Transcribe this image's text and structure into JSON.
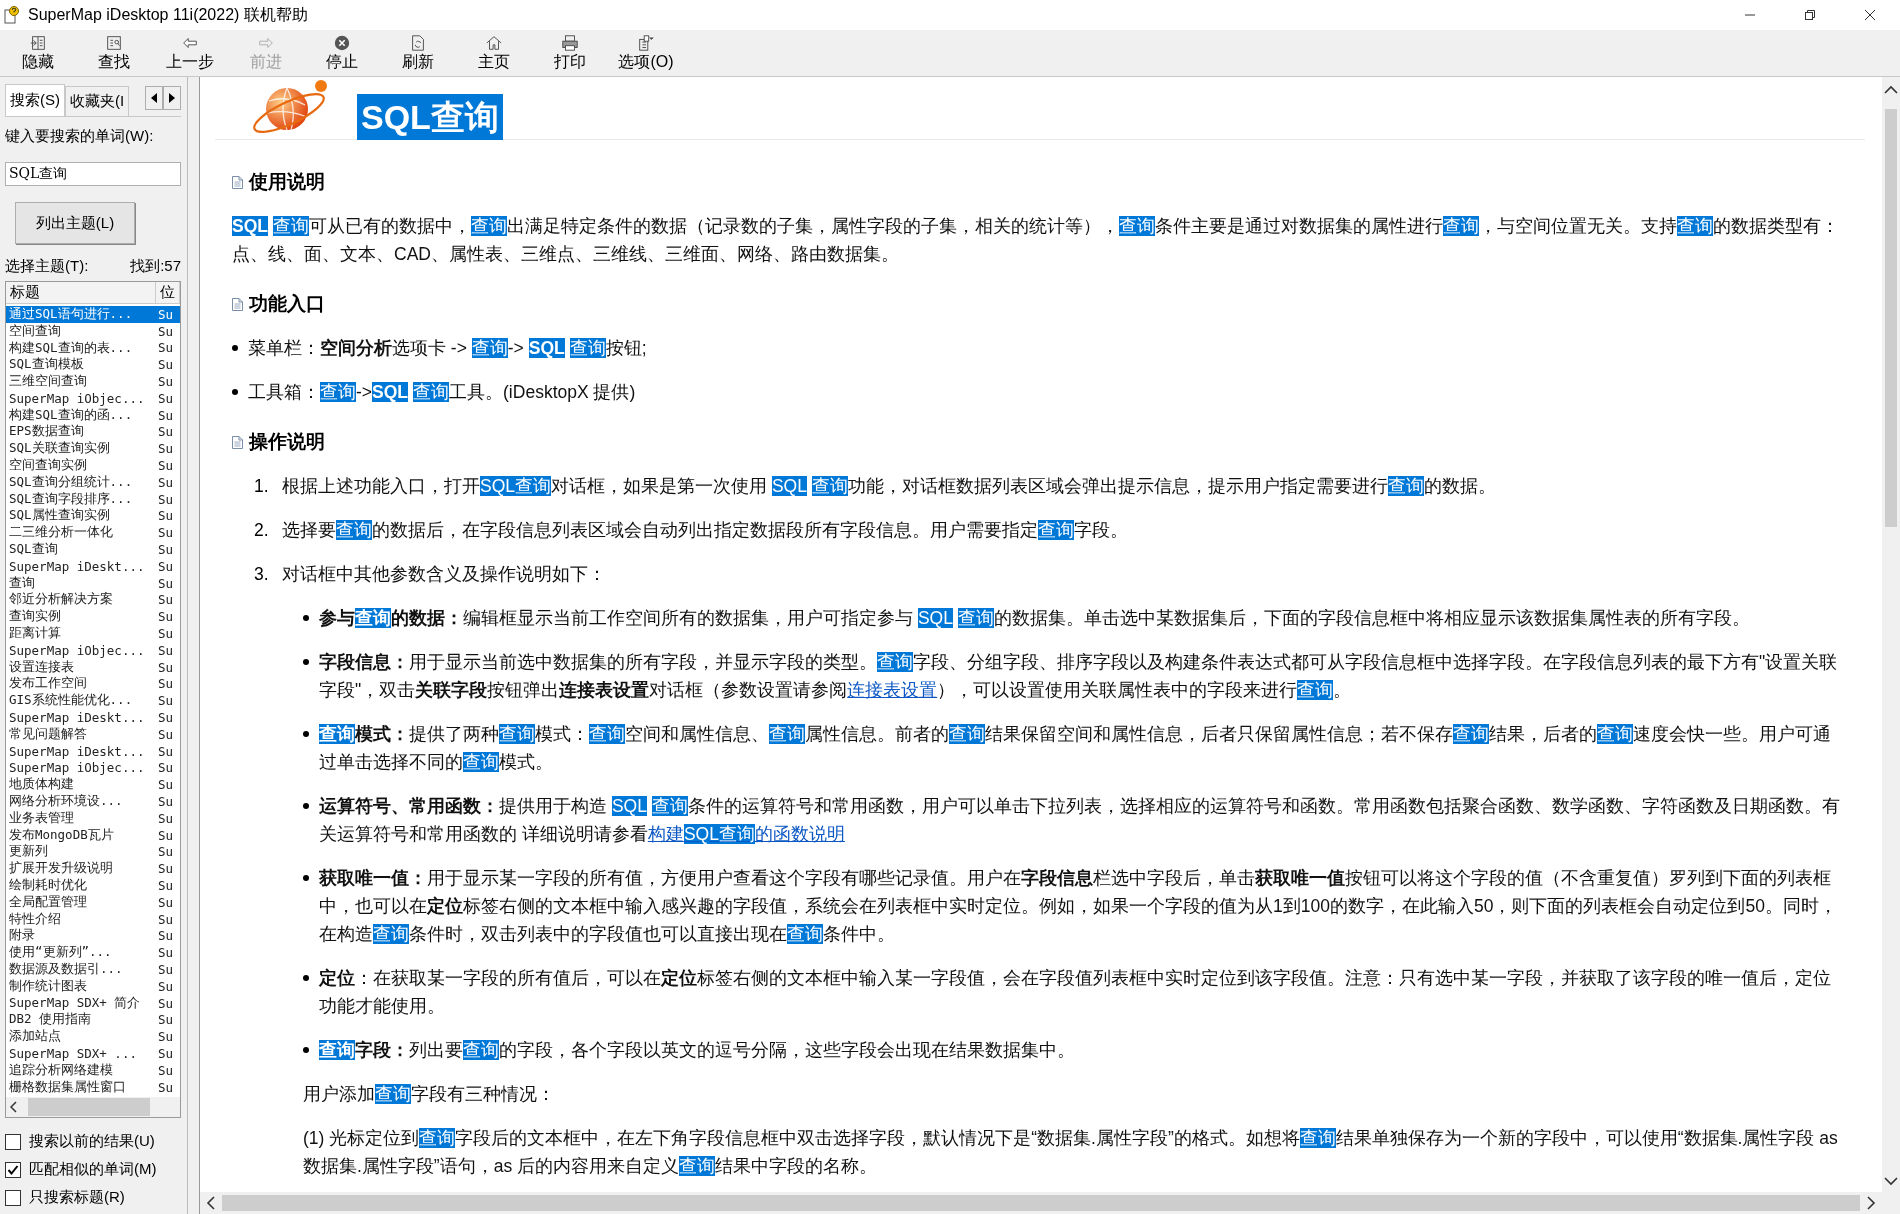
{
  "window": {
    "title": "SuperMap iDesktop 11i(2022) 联机帮助"
  },
  "toolbar": [
    {
      "label": "隐藏",
      "disabled": false
    },
    {
      "label": "查找",
      "disabled": false
    },
    {
      "label": "上一步",
      "disabled": false
    },
    {
      "label": "前进",
      "disabled": true
    },
    {
      "label": "停止",
      "disabled": false
    },
    {
      "label": "刷新",
      "disabled": false
    },
    {
      "label": "主页",
      "disabled": false
    },
    {
      "label": "打印",
      "disabled": false
    },
    {
      "label": "选项(O)",
      "disabled": false
    }
  ],
  "nav_pane": {
    "tabs": [
      {
        "label": "搜索(S)",
        "selected": true
      },
      {
        "label": "收藏夹(I",
        "selected": false
      }
    ],
    "search_label": "键入要搜索的单词(W):",
    "search_value": "SQL查询",
    "list_button": "列出主题(L)",
    "topics_label": "选择主题(T):",
    "found_count": "找到:57",
    "columns": [
      "标题",
      "位"
    ],
    "topics": [
      {
        "title": "通过SQL语句进行...",
        "location": "Su",
        "selected": true
      },
      {
        "title": "空间查询",
        "location": "Su",
        "selected": false
      },
      {
        "title": "构建SQL查询的表...",
        "location": "Su",
        "selected": false
      },
      {
        "title": "SQL查询模板",
        "location": "Su",
        "selected": false
      },
      {
        "title": "三维空间查询",
        "location": "Su",
        "selected": false
      },
      {
        "title": "SuperMap iObjec...",
        "location": "Su",
        "selected": false
      },
      {
        "title": "构建SQL查询的函...",
        "location": "Su",
        "selected": false
      },
      {
        "title": "EPS数据查询",
        "location": "Su",
        "selected": false
      },
      {
        "title": "SQL关联查询实例",
        "location": "Su",
        "selected": false
      },
      {
        "title": "空间查询实例",
        "location": "Su",
        "selected": false
      },
      {
        "title": "SQL查询分组统计...",
        "location": "Su",
        "selected": false
      },
      {
        "title": "SQL查询字段排序...",
        "location": "Su",
        "selected": false
      },
      {
        "title": "SQL属性查询实例",
        "location": "Su",
        "selected": false
      },
      {
        "title": "二三维分析一体化",
        "location": "Su",
        "selected": false
      },
      {
        "title": "SQL查询",
        "location": "Su",
        "selected": false
      },
      {
        "title": "SuperMap iDeskt...",
        "location": "Su",
        "selected": false
      },
      {
        "title": "查询",
        "location": "Su",
        "selected": false
      },
      {
        "title": "邻近分析解决方案",
        "location": "Su",
        "selected": false
      },
      {
        "title": "查询实例",
        "location": "Su",
        "selected": false
      },
      {
        "title": "距离计算",
        "location": "Su",
        "selected": false
      },
      {
        "title": "SuperMap iObjec...",
        "location": "Su",
        "selected": false
      },
      {
        "title": "设置连接表",
        "location": "Su",
        "selected": false
      },
      {
        "title": "发布工作空间",
        "location": "Su",
        "selected": false
      },
      {
        "title": "GIS系统性能优化...",
        "location": "Su",
        "selected": false
      },
      {
        "title": "SuperMap iDeskt...",
        "location": "Su",
        "selected": false
      },
      {
        "title": "常见问题解答",
        "location": "Su",
        "selected": false
      },
      {
        "title": "SuperMap iDeskt...",
        "location": "Su",
        "selected": false
      },
      {
        "title": "SuperMap iObjec...",
        "location": "Su",
        "selected": false
      },
      {
        "title": "地质体构建",
        "location": "Su",
        "selected": false
      },
      {
        "title": "网络分析环境设...",
        "location": "Su",
        "selected": false
      },
      {
        "title": "业务表管理",
        "location": "Su",
        "selected": false
      },
      {
        "title": "发布MongoDB瓦片",
        "location": "Su",
        "selected": false
      },
      {
        "title": "更新列",
        "location": "Su",
        "selected": false
      },
      {
        "title": "扩展开发升级说明",
        "location": "Su",
        "selected": false
      },
      {
        "title": "绘制耗时优化",
        "location": "Su",
        "selected": false
      },
      {
        "title": "全局配置管理",
        "location": "Su",
        "selected": false
      },
      {
        "title": "特性介绍",
        "location": "Su",
        "selected": false
      },
      {
        "title": "附录",
        "location": "Su",
        "selected": false
      },
      {
        "title": "使用“更新列”...",
        "location": "Su",
        "selected": false
      },
      {
        "title": "数据源及数据引...",
        "location": "Su",
        "selected": false
      },
      {
        "title": "制作统计图表",
        "location": "Su",
        "selected": false
      },
      {
        "title": "SuperMap SDX+ 简介",
        "location": "Su",
        "selected": false
      },
      {
        "title": "DB2 使用指南",
        "location": "Su",
        "selected": false
      },
      {
        "title": "添加站点",
        "location": "Su",
        "selected": false
      },
      {
        "title": "SuperMap SDX+ ...",
        "location": "Su",
        "selected": false
      },
      {
        "title": "追踪分析网络建模",
        "location": "Su",
        "selected": false
      },
      {
        "title": "栅格数据集属性窗口",
        "location": "Su",
        "selected": false
      }
    ],
    "options": [
      {
        "label": "搜索以前的结果(U)",
        "checked": false
      },
      {
        "label": "匹配相似的单词(M)",
        "checked": true
      },
      {
        "label": "只搜索标题(R)",
        "checked": false
      }
    ]
  },
  "page": {
    "title": {
      "text": "SQL查询",
      "highlighted": true
    },
    "sections": [
      {
        "heading": "使用说明",
        "blocks": [
          {
            "kind": "para",
            "segments": [
              {
                "kind": "boldhit",
                "t": "SQL"
              },
              {
                "kind": "hit",
                "t": "查询"
              },
              {
                "kind": "text",
                "t": "可从已有的数据中，"
              },
              {
                "kind": "hit",
                "t": "查询"
              },
              {
                "kind": "text",
                "t": "出满足特定条件的数据（记录数的子集，属性字段的子集，相关的统计等），"
              },
              {
                "kind": "hit",
                "t": "查询"
              },
              {
                "kind": "text",
                "t": "条件主要是通过对数据集的属性进行"
              },
              {
                "kind": "hit",
                "t": "查询"
              },
              {
                "kind": "text",
                "t": "，与空间位置无关。支持"
              },
              {
                "kind": "hit",
                "t": "查询"
              },
              {
                "kind": "text",
                "t": "的数据类型有：点、线、面、文本、CAD、属性表、三维点、三维线、三维面、网络、路由数据集。"
              }
            ]
          }
        ]
      },
      {
        "heading": "功能入口",
        "blocks": [
          {
            "kind": "bullet",
            "segments": [
              {
                "kind": "text",
                "t": "菜单栏："
              },
              {
                "kind": "bold",
                "t": "空间分析"
              },
              {
                "kind": "text",
                "t": "选项卡 -> "
              },
              {
                "kind": "hit",
                "t": "查询"
              },
              {
                "kind": "text",
                "t": "-> "
              },
              {
                "kind": "boldhit",
                "t": "SQL"
              },
              {
                "kind": "hit",
                "t": "查询"
              },
              {
                "kind": "text",
                "t": "按钮;"
              }
            ]
          },
          {
            "kind": "bullet",
            "segments": [
              {
                "kind": "text",
                "t": "工具箱："
              },
              {
                "kind": "hit",
                "t": "查询"
              },
              {
                "kind": "text",
                "t": "->"
              },
              {
                "kind": "boldhit",
                "t": "SQL"
              },
              {
                "kind": "hit",
                "t": "查询"
              },
              {
                "kind": "text",
                "t": "工具。(iDesktopX 提供)"
              }
            ]
          }
        ]
      },
      {
        "heading": "操作说明",
        "blocks": [
          {
            "kind": "step",
            "num": "1.",
            "segments": [
              {
                "kind": "text",
                "t": "根据上述功能入口，打开"
              },
              {
                "kind": "hit",
                "t": "SQL查询"
              },
              {
                "kind": "text",
                "t": "对话框，如果是第一次使用 "
              },
              {
                "kind": "hit",
                "t": "SQL"
              },
              {
                "kind": "hit",
                "t": "查询"
              },
              {
                "kind": "text",
                "t": "功能，对话框数据列表区域会弹出提示信息，提示用户指定需要进行"
              },
              {
                "kind": "hit",
                "t": "查询"
              },
              {
                "kind": "text",
                "t": "的数据。"
              }
            ]
          },
          {
            "kind": "step",
            "num": "2.",
            "segments": [
              {
                "kind": "text",
                "t": "选择要"
              },
              {
                "kind": "hit",
                "t": "查询"
              },
              {
                "kind": "text",
                "t": "的数据后，在字段信息列表区域会自动列出指定数据段所有字段信息。用户需要指定"
              },
              {
                "kind": "hit",
                "t": "查询"
              },
              {
                "kind": "text",
                "t": "字段。"
              }
            ]
          },
          {
            "kind": "step",
            "num": "3.",
            "segments": [
              {
                "kind": "text",
                "t": "对话框中其他参数含义及操作说明如下："
              }
            ],
            "children": [
              {
                "kind": "bullet",
                "segments": [
                  {
                    "kind": "bold",
                    "t": "参与"
                  },
                  {
                    "kind": "boldhit",
                    "t": "查询"
                  },
                  {
                    "kind": "bold",
                    "t": "的数据："
                  },
                  {
                    "kind": "text",
                    "t": "编辑框显示当前工作空间所有的数据集，用户可指定参与 "
                  },
                  {
                    "kind": "hit",
                    "t": "SQL"
                  },
                  {
                    "kind": "hit",
                    "t": "查询"
                  },
                  {
                    "kind": "text",
                    "t": "的数据集。单击选中某数据集后，下面的字段信息框中将相应显示该数据集属性表的所有字段。"
                  }
                ]
              },
              {
                "kind": "bullet",
                "segments": [
                  {
                    "kind": "bold",
                    "t": "字段信息："
                  },
                  {
                    "kind": "text",
                    "t": "用于显示当前选中数据集的所有字段，并显示字段的类型。"
                  },
                  {
                    "kind": "hit",
                    "t": "查询"
                  },
                  {
                    "kind": "text",
                    "t": "字段、分组字段、排序字段以及构建条件表达式都可从字段信息框中选择字段。在字段信息列表的最下方有\"设置关联字段\"，双击"
                  },
                  {
                    "kind": "bold",
                    "t": "关联字段"
                  },
                  {
                    "kind": "text",
                    "t": "按钮弹出"
                  },
                  {
                    "kind": "bold",
                    "t": "连接表设置"
                  },
                  {
                    "kind": "text",
                    "t": "对话框（参数设置请参阅"
                  },
                  {
                    "kind": "link",
                    "parts": [
                      {
                        "t": "连接表设置",
                        "hit": false
                      }
                    ]
                  },
                  {
                    "kind": "text",
                    "t": "），可以设置使用关联属性表中的字段来进行"
                  },
                  {
                    "kind": "hit",
                    "t": "查询"
                  },
                  {
                    "kind": "text",
                    "t": "。"
                  }
                ]
              },
              {
                "kind": "bullet",
                "segments": [
                  {
                    "kind": "boldhit",
                    "t": "查询"
                  },
                  {
                    "kind": "bold",
                    "t": "模式："
                  },
                  {
                    "kind": "text",
                    "t": "提供了两种"
                  },
                  {
                    "kind": "hit",
                    "t": "查询"
                  },
                  {
                    "kind": "text",
                    "t": "模式："
                  },
                  {
                    "kind": "hit",
                    "t": "查询"
                  },
                  {
                    "kind": "text",
                    "t": "空间和属性信息、"
                  },
                  {
                    "kind": "hit",
                    "t": "查询"
                  },
                  {
                    "kind": "text",
                    "t": "属性信息。前者的"
                  },
                  {
                    "kind": "hit",
                    "t": "查询"
                  },
                  {
                    "kind": "text",
                    "t": "结果保留空间和属性信息，后者只保留属性信息；若不保存"
                  },
                  {
                    "kind": "hit",
                    "t": "查询"
                  },
                  {
                    "kind": "text",
                    "t": "结果，后者的"
                  },
                  {
                    "kind": "hit",
                    "t": "查询"
                  },
                  {
                    "kind": "text",
                    "t": "速度会快一些。用户可通过单击选择不同的"
                  },
                  {
                    "kind": "hit",
                    "t": "查询"
                  },
                  {
                    "kind": "text",
                    "t": "模式。"
                  }
                ]
              },
              {
                "kind": "bullet",
                "segments": [
                  {
                    "kind": "bold",
                    "t": "运算符号、常用函数："
                  },
                  {
                    "kind": "text",
                    "t": "提供用于构造 "
                  },
                  {
                    "kind": "hit",
                    "t": "SQL"
                  },
                  {
                    "kind": "hit",
                    "t": "查询"
                  },
                  {
                    "kind": "text",
                    "t": "条件的运算符号和常用函数，用户可以单击下拉列表，选择相应的运算符号和函数。常用函数包括聚合函数、数学函数、字符函数及日期函数。有关运算符号和常用函数的 详细说明请参看"
                  },
                  {
                    "kind": "link",
                    "parts": [
                      {
                        "t": "构建",
                        "hit": false
                      },
                      {
                        "t": "SQL查询",
                        "hit": true
                      },
                      {
                        "t": "的函数说明",
                        "hit": false
                      }
                    ]
                  }
                ]
              },
              {
                "kind": "bullet",
                "segments": [
                  {
                    "kind": "bold",
                    "t": "获取唯一值："
                  },
                  {
                    "kind": "text",
                    "t": "用于显示某一字段的所有值，方便用户查看这个字段有哪些记录值。用户在"
                  },
                  {
                    "kind": "bold",
                    "t": "字段信息"
                  },
                  {
                    "kind": "text",
                    "t": "栏选中字段后，单击"
                  },
                  {
                    "kind": "bold",
                    "t": "获取唯一值"
                  },
                  {
                    "kind": "text",
                    "t": "按钮可以将这个字段的值（不含重复值）罗列到下面的列表框中，也可以在"
                  },
                  {
                    "kind": "bold",
                    "t": "定位"
                  },
                  {
                    "kind": "text",
                    "t": "标签右侧的文本框中输入感兴趣的字段值，系统会在列表框中实时定位。例如，如果一个字段的值为从1到100的数字，在此输入50，则下面的列表框会自动定位到50。同时，在构造"
                  },
                  {
                    "kind": "hit",
                    "t": "查询"
                  },
                  {
                    "kind": "text",
                    "t": "条件时，双击列表中的字段值也可以直接出现在"
                  },
                  {
                    "kind": "hit",
                    "t": "查询"
                  },
                  {
                    "kind": "text",
                    "t": "条件中。"
                  }
                ]
              },
              {
                "kind": "bullet",
                "segments": [
                  {
                    "kind": "bold",
                    "t": "定位"
                  },
                  {
                    "kind": "text",
                    "t": "：在获取某一字段的所有值后，可以在"
                  },
                  {
                    "kind": "bold",
                    "t": "定位"
                  },
                  {
                    "kind": "text",
                    "t": "标签右侧的文本框中输入某一字段值，会在字段值列表框中实时定位到该字段值。注意：只有选中某一字段，并获取了该字段的唯一值后，定位功能才能使用。"
                  }
                ]
              },
              {
                "kind": "bullet",
                "segments": [
                  {
                    "kind": "boldhit",
                    "t": "查询"
                  },
                  {
                    "kind": "bold",
                    "t": "字段："
                  },
                  {
                    "kind": "text",
                    "t": "列出要"
                  },
                  {
                    "kind": "hit",
                    "t": "查询"
                  },
                  {
                    "kind": "text",
                    "t": "的字段，各个字段以英文的逗号分隔，这些字段会出现在结果数据集中。"
                  }
                ]
              },
              {
                "kind": "para",
                "segments": [
                  {
                    "kind": "text",
                    "t": "用户添加"
                  },
                  {
                    "kind": "hit",
                    "t": "查询"
                  },
                  {
                    "kind": "text",
                    "t": "字段有三种情况："
                  }
                ]
              },
              {
                "kind": "para",
                "segments": [
                  {
                    "kind": "text",
                    "t": "(1) 光标定位到"
                  },
                  {
                    "kind": "hit",
                    "t": "查询"
                  },
                  {
                    "kind": "text",
                    "t": "字段后的文本框中，在左下角字段信息框中双击选择字段，默认情况下是“数据集.属性字段”的格式。如想将"
                  },
                  {
                    "kind": "hit",
                    "t": "查询"
                  },
                  {
                    "kind": "text",
                    "t": "结果单独保存为一个新的字段中，可以使用“数据集.属性字段 as 数据集.属性字段”语句，as 后的内容用来自定义"
                  },
                  {
                    "kind": "hit",
                    "t": "查询"
                  },
                  {
                    "kind": "text",
                    "t": "结果中字段的名称。"
                  }
                ]
              }
            ]
          }
        ]
      }
    ]
  }
}
